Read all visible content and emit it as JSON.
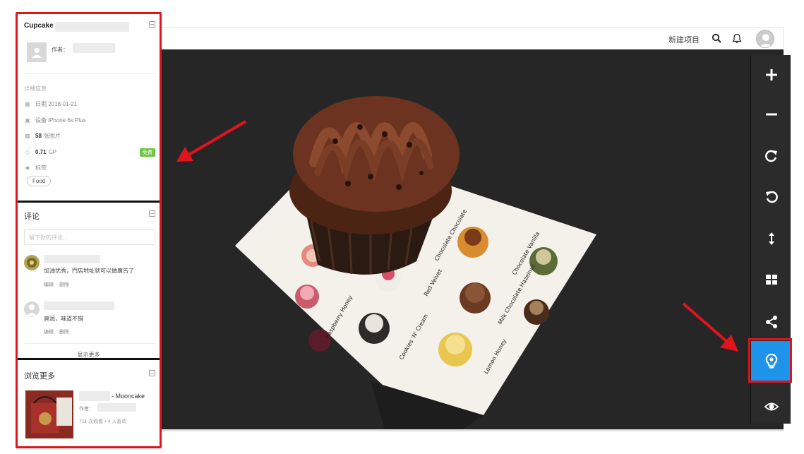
{
  "header": {
    "new_project": "新建项目",
    "icons": [
      "search-icon",
      "bell-icon",
      "user-avatar"
    ]
  },
  "info": {
    "title": "Cupcake",
    "author_label": "作者：",
    "details_heading": "详细信息",
    "date": "日期 2018-01-21",
    "device": "设备 iPhone 6s Plus",
    "images_count": "58",
    "images_label": "张图片",
    "gp_value": "0.71",
    "gp_label": "GP",
    "free_badge": "免费",
    "tags_label": "标签",
    "tag": "Food"
  },
  "comments": {
    "title": "评论",
    "placeholder": "留下你的评论...",
    "items": [
      {
        "text": "加油优秀，門店地址就可以做廣告了",
        "edit": "编辑",
        "delete": "删除"
      },
      {
        "text": "爽润，味道不错",
        "edit": "编辑",
        "delete": "删除"
      }
    ],
    "show_more": "显示更多"
  },
  "more": {
    "title": "浏览更多",
    "item_title": "- Mooncake",
    "item_author": "作者：",
    "item_stats": "711 次观看 • 4 人喜欢"
  },
  "toolbar": {
    "tools": [
      "zoom-in-icon",
      "zoom-out-icon",
      "rotate-cw-icon",
      "rotate-ccw-icon",
      "vertical-arrows-icon",
      "grid-icon",
      "share-icon",
      "light-bulb-icon",
      "eye-icon"
    ],
    "active": "light-bulb-icon",
    "active_color": "#1e93ea"
  },
  "annotation_color": "#e0141c",
  "viewer_bg": "#262626"
}
